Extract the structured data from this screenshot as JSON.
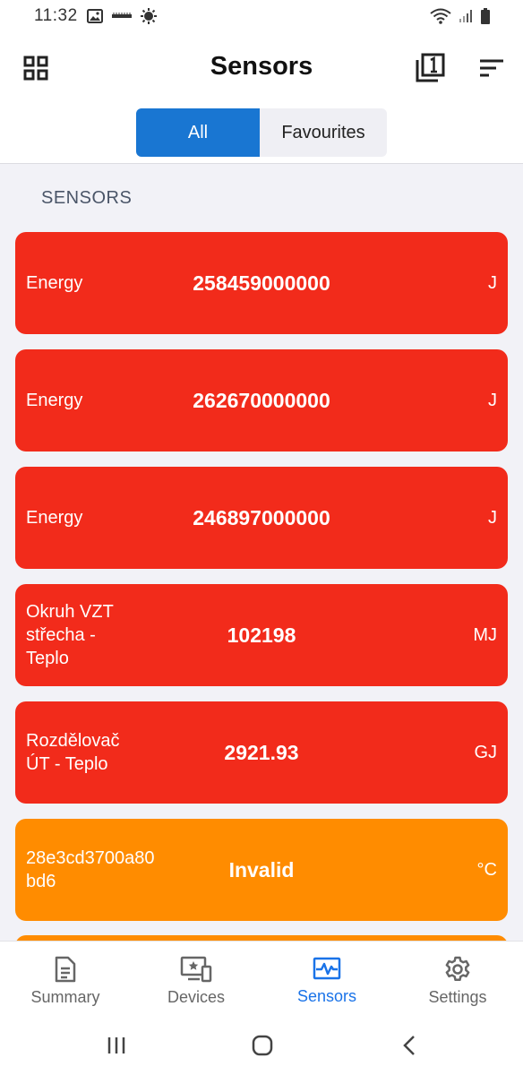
{
  "status_bar": {
    "time": "11:32"
  },
  "header": {
    "title": "Sensors"
  },
  "tabs": [
    {
      "label": "All",
      "active": true
    },
    {
      "label": "Favourites",
      "active": false
    }
  ],
  "section": {
    "label": "SENSORS"
  },
  "sensors": [
    {
      "name": "Energy",
      "value": "258459000000",
      "unit": "J",
      "status": "error",
      "color": "#f22b1b"
    },
    {
      "name": "Energy",
      "value": "262670000000",
      "unit": "J",
      "status": "error",
      "color": "#f22b1b"
    },
    {
      "name": "Energy",
      "value": "246897000000",
      "unit": "J",
      "status": "error",
      "color": "#f22b1b"
    },
    {
      "name": "Okruh VZT střecha - Teplo",
      "value": "102198",
      "unit": "MJ",
      "status": "error",
      "color": "#f22b1b"
    },
    {
      "name": "Rozdělovač ÚT - Teplo",
      "value": "2921.93",
      "unit": "GJ",
      "status": "error",
      "color": "#f22b1b"
    },
    {
      "name": "28e3cd3700a80bd6",
      "value": "Invalid",
      "unit": "°C",
      "status": "warning",
      "color": "#ff8c00"
    }
  ],
  "bottom_nav": [
    {
      "label": "Summary",
      "icon": "document-icon",
      "active": false
    },
    {
      "label": "Devices",
      "icon": "devices-icon",
      "active": false
    },
    {
      "label": "Sensors",
      "icon": "sensor-wave-icon",
      "active": true
    },
    {
      "label": "Settings",
      "icon": "gear-icon",
      "active": false
    }
  ],
  "colors": {
    "accent": "#1976d2",
    "error": "#f22b1b",
    "warning": "#ff8c00"
  }
}
